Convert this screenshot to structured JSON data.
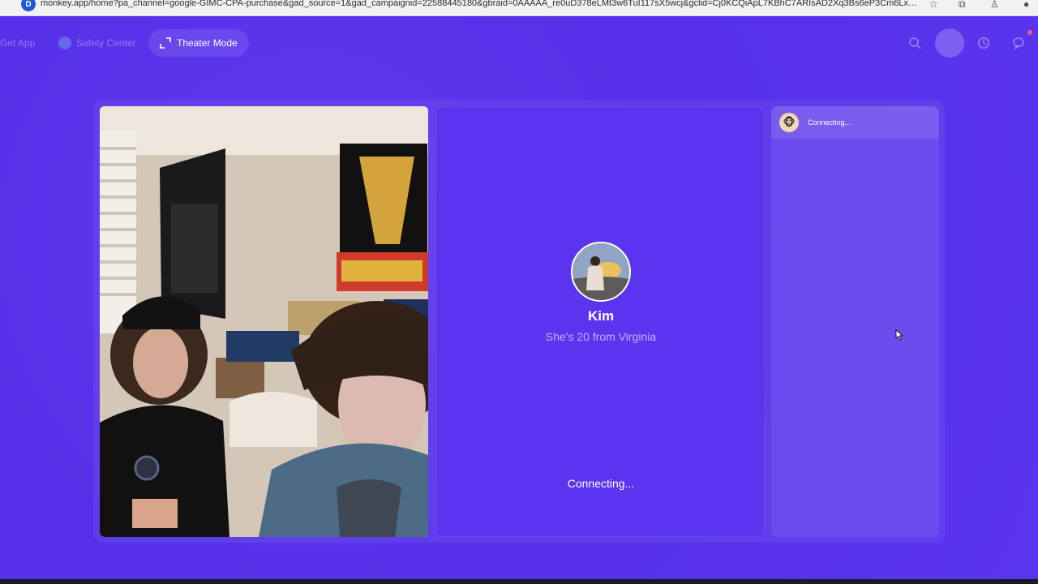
{
  "browser": {
    "site_badge": "D",
    "url": "monkey.app/home?pa_channel=google-GIMC-CPA-purchase&gad_source=1&gad_campaignid=22588445180&gbraid=0AAAAA_re0uD378eLMt3w6TuI117sX5wcj&gclid=Cj0KCQiApL7KBhC7ARIsAD2Xq3Bs6eP3Cm6LxyXAzvnrqHqsz2notj..."
  },
  "nav": {
    "get_app": "Get App",
    "safety_center": "Safety Center",
    "theater_mode": "Theater Mode"
  },
  "remote": {
    "name": "Kim",
    "bio": "She's 20 from Virginia",
    "status": "Connecting..."
  },
  "chat": {
    "status": "Connecting..."
  },
  "icons": [
    "search-icon",
    "crown-icon",
    "history-icon",
    "message-icon",
    "expand-icon",
    "star-icon",
    "extensions-icon",
    "profile-icon"
  ],
  "colors": {
    "background": "#5b34ec",
    "panel": "#5a34ee",
    "text": "#ffffff"
  }
}
